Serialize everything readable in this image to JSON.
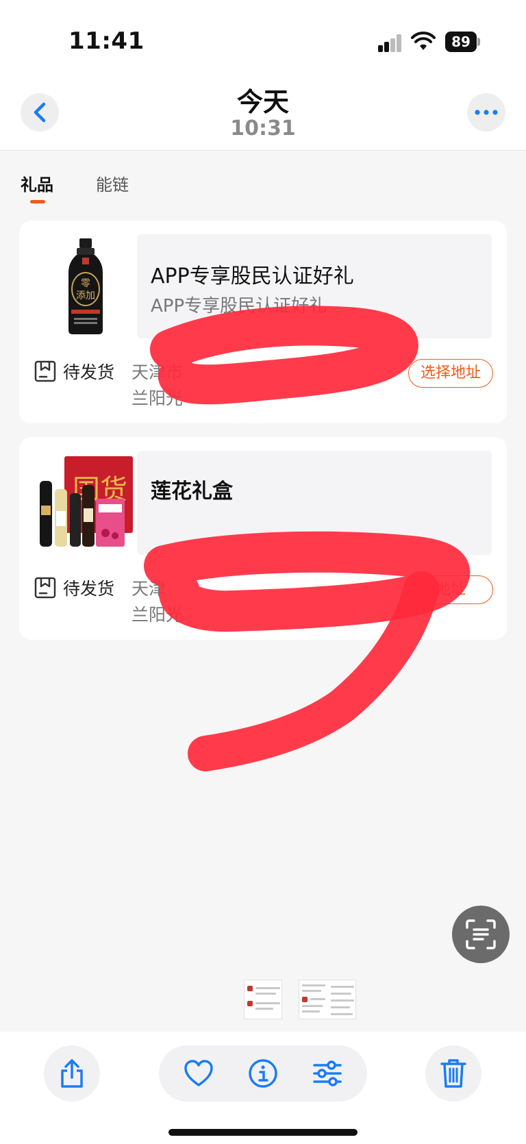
{
  "status_bar": {
    "time": "11:41",
    "battery": "89"
  },
  "viewer": {
    "title": "今天",
    "subtitle": "10:31"
  },
  "tabs": [
    {
      "label": "礼品",
      "active": true
    },
    {
      "label": "能链",
      "active": false
    }
  ],
  "gifts": [
    {
      "title": "APP专享股民认证好礼",
      "subtitle": "APP专享股民认证好礼",
      "status": "待发货",
      "address_line1": "天津市",
      "address_line2": "兰阳光",
      "action": "选择地址"
    },
    {
      "title": "莲花礼盒",
      "subtitle": "",
      "status": "待发货",
      "address_line1": "天津",
      "address_line2": "兰阳光",
      "action": "地址"
    }
  ],
  "colors": {
    "accent": "#f25a16",
    "ios_blue": "#1a7cf5",
    "redaction": "#ff2a3c"
  },
  "icons": [
    "back-chevron-icon",
    "more-dots-icon",
    "package-icon",
    "live-text-icon",
    "share-icon",
    "heart-icon",
    "info-icon",
    "adjust-icon",
    "trash-icon"
  ]
}
